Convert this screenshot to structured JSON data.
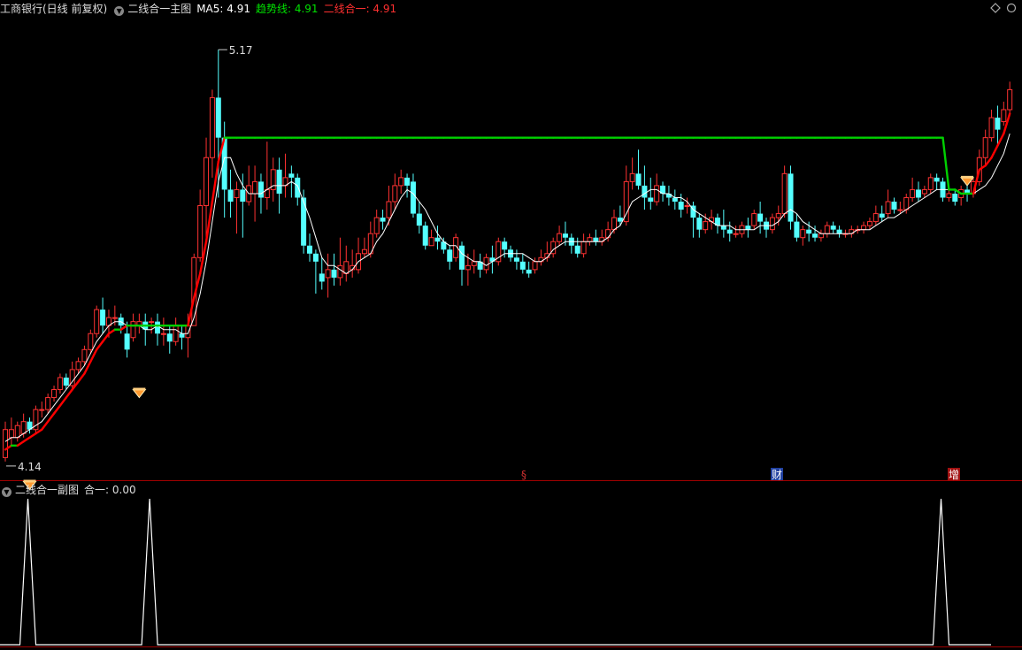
{
  "header": {
    "stock_name": "工商银行(日线 前复权)",
    "indicator_title": "二线合一主图",
    "ma5_label": "MA5: 4.91",
    "trend_label": "趋势线: 4.91",
    "combined_label": "二线合一: 4.91"
  },
  "sub_header": {
    "title": "二线合一副图",
    "value_label": "合一: 0.00"
  },
  "markers": {
    "high_label": "5.17",
    "low_label": "4.14",
    "event_1": "§",
    "event_2": "财",
    "event_3": "增"
  },
  "colors": {
    "up": "#ff3232",
    "down": "#54ffff",
    "ma5": "#ffffff",
    "trend": "#00d000",
    "combined_red": "#ff0000",
    "ma5_text": "#ffffff",
    "trend_text": "#00e000",
    "combined_text": "#ff3030",
    "divider": "#a00000"
  },
  "chart_data": [
    {
      "type": "candlestick",
      "title": "二线合一主图",
      "ylim": [
        4.1,
        5.25
      ],
      "candles": [
        [
          4.15,
          4.22,
          4.14,
          4.24
        ],
        [
          4.2,
          4.22,
          4.18,
          4.25
        ],
        [
          4.2,
          4.23,
          4.19,
          4.24
        ],
        [
          4.21,
          4.24,
          4.2,
          4.26
        ],
        [
          4.24,
          4.22,
          4.21,
          4.25
        ],
        [
          4.22,
          4.27,
          4.21,
          4.28
        ],
        [
          4.27,
          4.27,
          4.25,
          4.29
        ],
        [
          4.27,
          4.3,
          4.26,
          4.31
        ],
        [
          4.3,
          4.32,
          4.29,
          4.33
        ],
        [
          4.32,
          4.35,
          4.31,
          4.36
        ],
        [
          4.35,
          4.33,
          4.32,
          4.36
        ],
        [
          4.33,
          4.37,
          4.32,
          4.39
        ],
        [
          4.37,
          4.39,
          4.36,
          4.4
        ],
        [
          4.39,
          4.42,
          4.38,
          4.43
        ],
        [
          4.42,
          4.46,
          4.41,
          4.47
        ],
        [
          4.46,
          4.52,
          4.45,
          4.53
        ],
        [
          4.52,
          4.48,
          4.46,
          4.55
        ],
        [
          4.48,
          4.5,
          4.45,
          4.52
        ],
        [
          4.5,
          4.5,
          4.48,
          4.53
        ],
        [
          4.5,
          4.48,
          4.46,
          4.51
        ],
        [
          4.46,
          4.42,
          4.4,
          4.49
        ],
        [
          4.45,
          4.49,
          4.44,
          4.51
        ],
        [
          4.48,
          4.49,
          4.46,
          4.51
        ],
        [
          4.49,
          4.47,
          4.43,
          4.51
        ],
        [
          4.49,
          4.49,
          4.46,
          4.5
        ],
        [
          4.49,
          4.46,
          4.43,
          4.51
        ],
        [
          4.46,
          4.46,
          4.43,
          4.5
        ],
        [
          4.46,
          4.44,
          4.41,
          4.48
        ],
        [
          4.44,
          4.48,
          4.43,
          4.5
        ],
        [
          4.46,
          4.45,
          4.42,
          4.48
        ],
        [
          4.45,
          4.48,
          4.4,
          4.51
        ],
        [
          4.48,
          4.65,
          4.48,
          4.66
        ],
        [
          4.65,
          4.78,
          4.64,
          4.82
        ],
        [
          4.78,
          4.9,
          4.7,
          4.95
        ],
        [
          4.9,
          5.05,
          4.85,
          5.07
        ],
        [
          5.05,
          4.95,
          4.8,
          5.17
        ],
        [
          4.95,
          4.82,
          4.75,
          4.99
        ],
        [
          4.82,
          4.79,
          4.75,
          4.87
        ],
        [
          4.8,
          4.82,
          4.71,
          4.84
        ],
        [
          4.82,
          4.79,
          4.7,
          4.86
        ],
        [
          4.79,
          4.83,
          4.78,
          4.88
        ],
        [
          4.81,
          4.84,
          4.74,
          4.88
        ],
        [
          4.84,
          4.8,
          4.76,
          4.86
        ],
        [
          4.8,
          4.82,
          4.77,
          4.94
        ],
        [
          4.82,
          4.87,
          4.79,
          4.9
        ],
        [
          4.87,
          4.81,
          4.76,
          4.9
        ],
        [
          4.83,
          4.85,
          4.8,
          4.91
        ],
        [
          4.86,
          4.85,
          4.8,
          4.88
        ],
        [
          4.85,
          4.8,
          4.78,
          4.86
        ],
        [
          4.8,
          4.68,
          4.66,
          4.82
        ],
        [
          4.68,
          4.66,
          4.64,
          4.71
        ],
        [
          4.66,
          4.64,
          4.56,
          4.67
        ],
        [
          4.61,
          4.59,
          4.57,
          4.65
        ],
        [
          4.6,
          4.62,
          4.55,
          4.66
        ],
        [
          4.62,
          4.6,
          4.58,
          4.66
        ],
        [
          4.6,
          4.63,
          4.58,
          4.7
        ],
        [
          4.61,
          4.64,
          4.59,
          4.68
        ],
        [
          4.62,
          4.63,
          4.6,
          4.67
        ],
        [
          4.62,
          4.66,
          4.61,
          4.7
        ],
        [
          4.66,
          4.67,
          4.65,
          4.7
        ],
        [
          4.66,
          4.71,
          4.65,
          4.74
        ],
        [
          4.71,
          4.75,
          4.7,
          4.77
        ],
        [
          4.75,
          4.74,
          4.72,
          4.77
        ],
        [
          4.75,
          4.79,
          4.73,
          4.83
        ],
        [
          4.79,
          4.83,
          4.77,
          4.86
        ],
        [
          4.83,
          4.85,
          4.81,
          4.87
        ],
        [
          4.85,
          4.83,
          4.8,
          4.86
        ],
        [
          4.84,
          4.76,
          4.75,
          4.86
        ],
        [
          4.76,
          4.73,
          4.71,
          4.79
        ],
        [
          4.73,
          4.68,
          4.67,
          4.74
        ],
        [
          4.68,
          4.7,
          4.68,
          4.72
        ],
        [
          4.7,
          4.69,
          4.67,
          4.73
        ],
        [
          4.69,
          4.67,
          4.66,
          4.7
        ],
        [
          4.67,
          4.64,
          4.62,
          4.68
        ],
        [
          4.65,
          4.7,
          4.64,
          4.71
        ],
        [
          4.68,
          4.62,
          4.58,
          4.69
        ],
        [
          4.62,
          4.63,
          4.58,
          4.66
        ],
        [
          4.63,
          4.64,
          4.61,
          4.67
        ],
        [
          4.64,
          4.62,
          4.6,
          4.66
        ],
        [
          4.62,
          4.65,
          4.61,
          4.66
        ],
        [
          4.65,
          4.64,
          4.61,
          4.68
        ],
        [
          4.64,
          4.69,
          4.63,
          4.7
        ],
        [
          4.69,
          4.67,
          4.65,
          4.7
        ],
        [
          4.67,
          4.65,
          4.64,
          4.68
        ],
        [
          4.65,
          4.64,
          4.62,
          4.67
        ],
        [
          4.64,
          4.62,
          4.61,
          4.66
        ],
        [
          4.62,
          4.61,
          4.6,
          4.64
        ],
        [
          4.62,
          4.64,
          4.61,
          4.65
        ],
        [
          4.64,
          4.65,
          4.63,
          4.67
        ],
        [
          4.65,
          4.66,
          4.64,
          4.69
        ],
        [
          4.66,
          4.69,
          4.65,
          4.7
        ],
        [
          4.69,
          4.71,
          4.68,
          4.73
        ],
        [
          4.71,
          4.7,
          4.68,
          4.74
        ],
        [
          4.7,
          4.68,
          4.66,
          4.71
        ],
        [
          4.68,
          4.66,
          4.65,
          4.7
        ],
        [
          4.66,
          4.69,
          4.65,
          4.71
        ],
        [
          4.69,
          4.7,
          4.68,
          4.71
        ],
        [
          4.7,
          4.69,
          4.68,
          4.72
        ],
        [
          4.69,
          4.7,
          4.68,
          4.72
        ],
        [
          4.7,
          4.72,
          4.69,
          4.74
        ],
        [
          4.72,
          4.75,
          4.71,
          4.77
        ],
        [
          4.75,
          4.74,
          4.73,
          4.78
        ],
        [
          4.74,
          4.84,
          4.73,
          4.88
        ],
        [
          4.84,
          4.86,
          4.82,
          4.9
        ],
        [
          4.86,
          4.83,
          4.82,
          4.92
        ],
        [
          4.83,
          4.8,
          4.77,
          4.88
        ],
        [
          4.8,
          4.79,
          4.77,
          4.85
        ],
        [
          4.79,
          4.83,
          4.78,
          4.86
        ],
        [
          4.83,
          4.81,
          4.79,
          4.84
        ],
        [
          4.81,
          4.8,
          4.78,
          4.83
        ],
        [
          4.8,
          4.79,
          4.77,
          4.82
        ],
        [
          4.79,
          4.77,
          4.75,
          4.81
        ],
        [
          4.78,
          4.78,
          4.76,
          4.8
        ],
        [
          4.78,
          4.75,
          4.7,
          4.79
        ],
        [
          4.75,
          4.72,
          4.7,
          4.76
        ],
        [
          4.72,
          4.74,
          4.71,
          4.76
        ],
        [
          4.74,
          4.75,
          4.72,
          4.77
        ],
        [
          4.75,
          4.73,
          4.71,
          4.76
        ],
        [
          4.73,
          4.72,
          4.7,
          4.77
        ],
        [
          4.72,
          4.71,
          4.69,
          4.74
        ],
        [
          4.71,
          4.71,
          4.7,
          4.73
        ],
        [
          4.71,
          4.73,
          4.7,
          4.74
        ],
        [
          4.73,
          4.72,
          4.7,
          4.75
        ],
        [
          4.73,
          4.76,
          4.72,
          4.77
        ],
        [
          4.76,
          4.74,
          4.71,
          4.79
        ],
        [
          4.74,
          4.72,
          4.7,
          4.75
        ],
        [
          4.72,
          4.75,
          4.71,
          4.76
        ],
        [
          4.75,
          4.76,
          4.73,
          4.78
        ],
        [
          4.76,
          4.86,
          4.75,
          4.88
        ],
        [
          4.86,
          4.74,
          4.72,
          4.88
        ],
        [
          4.74,
          4.7,
          4.69,
          4.76
        ],
        [
          4.7,
          4.72,
          4.68,
          4.73
        ],
        [
          4.72,
          4.71,
          4.69,
          4.74
        ],
        [
          4.71,
          4.7,
          4.69,
          4.73
        ],
        [
          4.7,
          4.71,
          4.69,
          4.72
        ],
        [
          4.71,
          4.73,
          4.7,
          4.74
        ],
        [
          4.73,
          4.72,
          4.71,
          4.74
        ],
        [
          4.72,
          4.71,
          4.7,
          4.73
        ],
        [
          4.71,
          4.71,
          4.7,
          4.72
        ],
        [
          4.71,
          4.72,
          4.7,
          4.73
        ],
        [
          4.72,
          4.72,
          4.71,
          4.73
        ],
        [
          4.72,
          4.73,
          4.71,
          4.74
        ],
        [
          4.73,
          4.74,
          4.72,
          4.75
        ],
        [
          4.74,
          4.76,
          4.73,
          4.78
        ],
        [
          4.76,
          4.75,
          4.74,
          4.78
        ],
        [
          4.76,
          4.79,
          4.75,
          4.82
        ],
        [
          4.79,
          4.77,
          4.76,
          4.8
        ],
        [
          4.77,
          4.77,
          4.76,
          4.79
        ],
        [
          4.77,
          4.8,
          4.76,
          4.81
        ],
        [
          4.8,
          4.82,
          4.79,
          4.85
        ],
        [
          4.82,
          4.8,
          4.79,
          4.84
        ],
        [
          4.81,
          4.82,
          4.8,
          4.83
        ],
        [
          4.82,
          4.85,
          4.81,
          4.86
        ],
        [
          4.85,
          4.84,
          4.82,
          4.86
        ],
        [
          4.84,
          4.8,
          4.79,
          4.85
        ],
        [
          4.8,
          4.81,
          4.79,
          4.83
        ],
        [
          4.81,
          4.79,
          4.78,
          4.82
        ],
        [
          4.8,
          4.82,
          4.78,
          4.83
        ],
        [
          4.82,
          4.81,
          4.79,
          4.83
        ],
        [
          4.81,
          4.84,
          4.8,
          4.85
        ],
        [
          4.84,
          4.9,
          4.83,
          4.92
        ],
        [
          4.9,
          4.95,
          4.88,
          4.97
        ],
        [
          4.95,
          5.0,
          4.94,
          5.02
        ],
        [
          5.0,
          4.97,
          4.93,
          5.03
        ],
        [
          4.99,
          5.02,
          4.98,
          5.04
        ],
        [
          5.02,
          5.07,
          5.01,
          5.09
        ]
      ],
      "ma5": [
        4.19,
        4.2,
        4.2,
        4.21,
        4.22,
        4.23,
        4.24,
        4.26,
        4.28,
        4.3,
        4.32,
        4.34,
        4.36,
        4.38,
        4.41,
        4.44,
        4.46,
        4.48,
        4.49,
        4.49,
        4.48,
        4.48,
        4.48,
        4.47,
        4.47,
        4.48,
        4.47,
        4.47,
        4.47,
        4.46,
        4.46,
        4.5,
        4.56,
        4.64,
        4.74,
        4.84,
        4.9,
        4.9,
        4.86,
        4.83,
        4.81,
        4.81,
        4.81,
        4.82,
        4.83,
        4.83,
        4.83,
        4.84,
        4.83,
        4.79,
        4.75,
        4.7,
        4.65,
        4.63,
        4.63,
        4.62,
        4.61,
        4.62,
        4.64,
        4.65,
        4.66,
        4.69,
        4.71,
        4.74,
        4.77,
        4.8,
        4.82,
        4.81,
        4.79,
        4.77,
        4.74,
        4.71,
        4.69,
        4.68,
        4.68,
        4.66,
        4.65,
        4.64,
        4.64,
        4.63,
        4.64,
        4.65,
        4.66,
        4.66,
        4.66,
        4.66,
        4.65,
        4.64,
        4.64,
        4.65,
        4.67,
        4.68,
        4.69,
        4.69,
        4.69,
        4.69,
        4.69,
        4.69,
        4.69,
        4.7,
        4.72,
        4.73,
        4.76,
        4.79,
        4.8,
        4.81,
        4.82,
        4.82,
        4.81,
        4.81,
        4.8,
        4.8,
        4.79,
        4.77,
        4.76,
        4.75,
        4.74,
        4.73,
        4.73,
        4.73,
        4.72,
        4.72,
        4.72,
        4.72,
        4.73,
        4.73,
        4.73,
        4.74,
        4.76,
        4.77,
        4.76,
        4.74,
        4.73,
        4.72,
        4.71,
        4.71,
        4.71,
        4.71,
        4.71,
        4.71,
        4.72,
        4.72,
        4.72,
        4.73,
        4.74,
        4.75,
        4.75,
        4.76,
        4.77,
        4.78,
        4.79,
        4.8,
        4.81,
        4.82,
        4.82,
        4.82,
        4.82,
        4.81,
        4.81,
        4.81,
        4.82,
        4.83,
        4.85,
        4.88,
        4.91,
        4.96
      ]
    },
    {
      "type": "line",
      "title": "二线合一副图",
      "series": [
        {
          "name": "合一",
          "values_nonzero_at": [
            4,
            24,
            154
          ],
          "peak": 1,
          "base": 0
        }
      ]
    }
  ]
}
